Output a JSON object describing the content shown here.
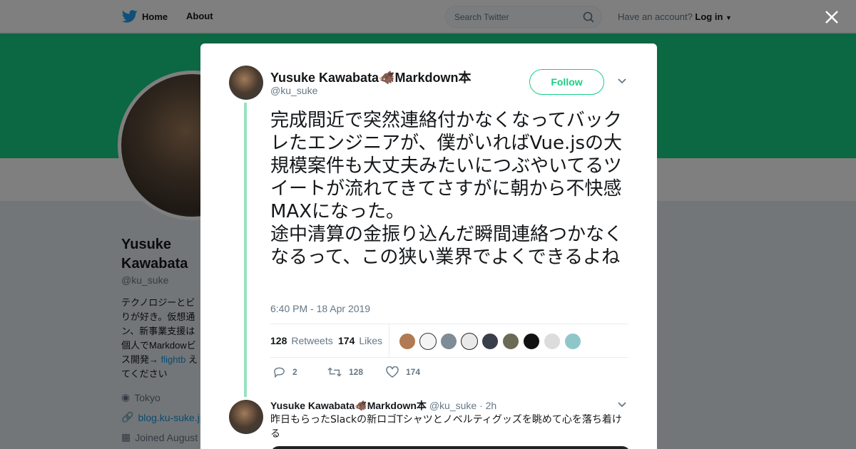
{
  "nav": {
    "home_label": "Home",
    "about_label": "About",
    "search_placeholder": "Search Twitter",
    "account_prompt": "Have an account?",
    "login_label": "Log in",
    "brand_color": "#1da1f2"
  },
  "profile": {
    "name": "Yusuke Kawabata",
    "handle": "@ku_suke",
    "bio": "テクノロジーとビりが好き。仮想通ン、新事業支援は個人でMarkdowビス開発→",
    "bio_link": "flightb",
    "bio_tail": "えてください",
    "location": "Tokyo",
    "website": "blog.ku-suke.jp",
    "joined": "Joined August",
    "banner_color": "#19cf86"
  },
  "tweet": {
    "author_name": "Yusuke Kawabata🐗Markdown本",
    "author_handle": "@ku_suke",
    "follow_label": "Follow",
    "text": "完成間近で突然連絡付かなくなってバックレたエンジニアが、僕がいればVue.jsの大規模案件も大丈夫みたいにつぶやいてるツイートが流れてきてさすがに朝から不快感MAXになった。\n途中清算の金振り込んだ瞬間連絡つかなくなるって、この狭い業界でよくできるよね",
    "timestamp": "6:40 PM - 18 Apr 2019",
    "retweets_count": "128",
    "retweets_label": "Retweets",
    "likes_count": "174",
    "likes_label": "Likes",
    "reply_count": "2",
    "retweet_action_count": "128",
    "like_action_count": "174"
  },
  "reply": {
    "author_name": "Yusuke Kawabata🐗Markdown本",
    "author_handle": "@ku_suke",
    "time": "· 2h",
    "text": "昨日もらったSlackの新ロゴTシャツとノベルティグッズを眺めて心を落ち着ける"
  },
  "colors": {
    "accent": "#19cf86",
    "thread_line": "#98e2c1",
    "muted": "#657786"
  }
}
